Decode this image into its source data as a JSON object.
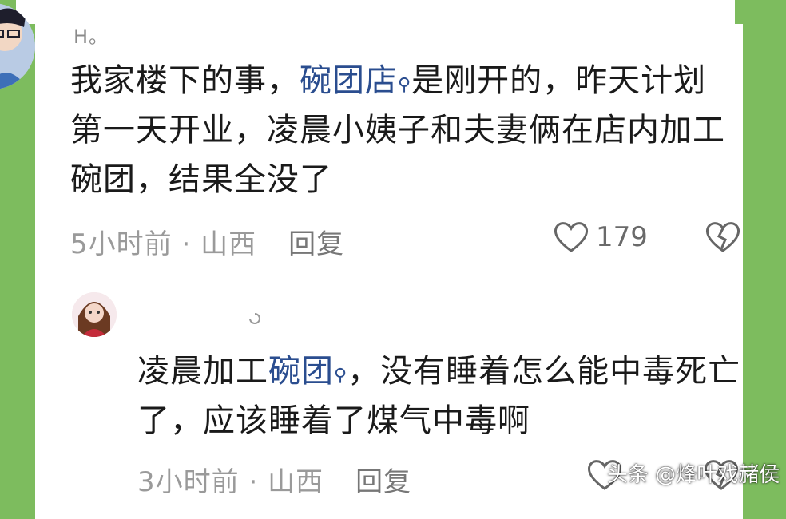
{
  "comment1": {
    "cut_text": "H。",
    "text_before": "我家楼下的事，",
    "link_text": "碗团店",
    "text_after": "是刚开的，昨天计划第一天开业，凌晨小姨子和夫妻俩在店内加工碗团，结果全没了",
    "time": "5小时前",
    "location": "山西",
    "reply_label": "回复",
    "like_count": "179"
  },
  "comment2": {
    "text_before": "凌晨加工",
    "link_text": "碗团",
    "text_after": "，没有睡着怎么能中毒死亡了，应该睡着了煤气中毒啊",
    "time": "3小时前",
    "location": "山西",
    "reply_label": "回复"
  },
  "watermark": "头条 @烽叶戏赭侯",
  "colors": {
    "background": "#7dbc5e",
    "link": "#2a4d8f",
    "meta": "#9a9a9a"
  }
}
